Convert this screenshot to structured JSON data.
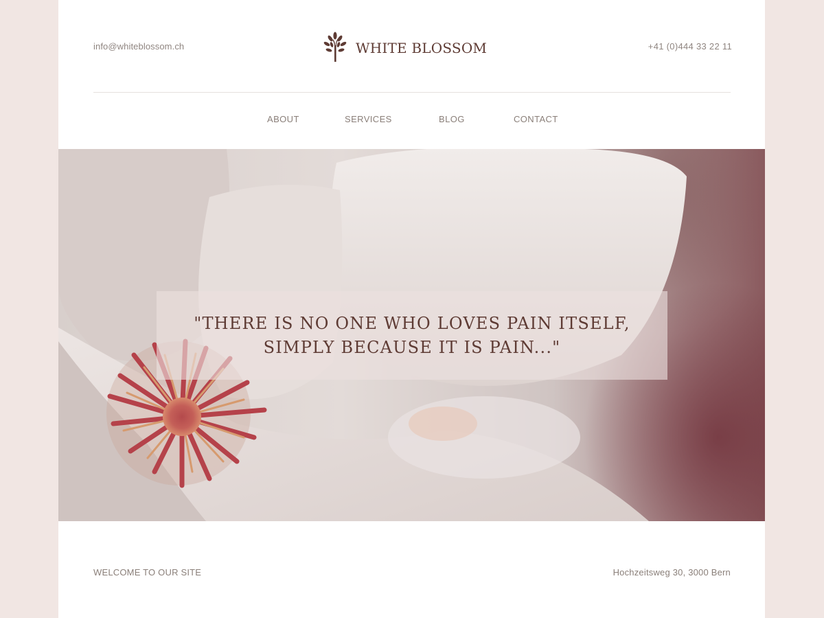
{
  "header": {
    "email": "info@whiteblossom.ch",
    "phone": "+41 (0)444 33 22 11",
    "logo": {
      "icon": "tree-icon",
      "text": "WHITE BLOSSOM"
    }
  },
  "nav": {
    "items": [
      {
        "label": "ABOUT"
      },
      {
        "label": "SERVICES"
      },
      {
        "label": "BLOG"
      },
      {
        "label": "CONTACT"
      }
    ]
  },
  "hero": {
    "quote": "\"THERE IS NO ONE WHO LOVES PAIN ITSELF,\nSIMPLY BECAUSE IT IS PAIN...\""
  },
  "footer": {
    "welcome": "WELCOME TO OUR SITE",
    "address": "Hochzeitsweg 30, 3000 Bern"
  },
  "colors": {
    "page_background": "#f1e6e3",
    "brand": "#5e3b34",
    "muted_text": "#8a7f79",
    "quote_box": "#ebe1de"
  }
}
